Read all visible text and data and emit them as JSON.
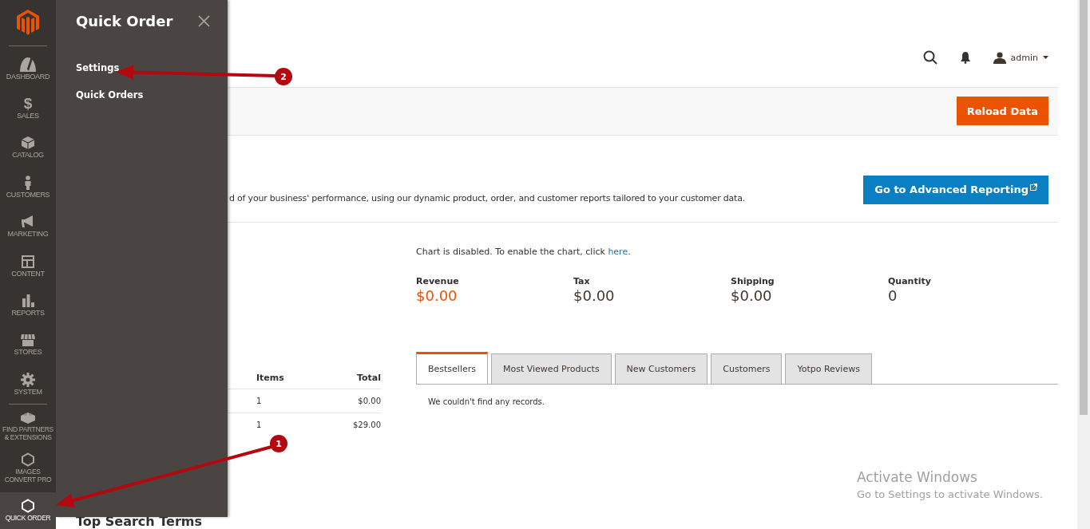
{
  "sidebar": {
    "items": [
      {
        "label": "DASHBOARD",
        "selected": false
      },
      {
        "label": "SALES",
        "glyph": "$",
        "selected": false
      },
      {
        "label": "CATALOG",
        "selected": false
      },
      {
        "label": "CUSTOMERS",
        "selected": false
      },
      {
        "label": "MARKETING",
        "selected": false
      },
      {
        "label": "CONTENT",
        "selected": false
      },
      {
        "label": "REPORTS",
        "selected": false
      },
      {
        "label": "STORES",
        "selected": false
      },
      {
        "label": "SYSTEM",
        "selected": false
      },
      {
        "label": "FIND PARTNERS & EXTENSIONS",
        "selected": false
      },
      {
        "label": "IMAGES CONVERT PRO",
        "selected": false
      },
      {
        "label": "QUICK ORDER",
        "selected": true
      }
    ]
  },
  "flyout": {
    "title": "Quick Order",
    "items": [
      "Settings",
      "Quick Orders"
    ]
  },
  "header": {
    "user": "admin"
  },
  "reload_button": "Reload Data",
  "reporting": {
    "description": "d of your business' performance, using our dynamic product, order, and customer reports tailored to your customer data.",
    "button": "Go to Advanced Reporting"
  },
  "chart_notice": {
    "text": "Chart is disabled. To enable the chart, click ",
    "link": "here",
    "end": "."
  },
  "totals": [
    {
      "label": "Revenue",
      "value": "$0.00",
      "highlight": true
    },
    {
      "label": "Tax",
      "value": "$0.00",
      "highlight": false
    },
    {
      "label": "Shipping",
      "value": "$0.00",
      "highlight": false
    },
    {
      "label": "Quantity",
      "value": "0",
      "highlight": false
    }
  ],
  "last_orders": {
    "columns": [
      "Items",
      "Total"
    ],
    "rows": [
      [
        "1",
        "$0.00"
      ],
      [
        "1",
        "$29.00"
      ]
    ]
  },
  "top_search_heading": "Top Search Terms",
  "tabs": [
    {
      "label": "Bestsellers",
      "selected": true
    },
    {
      "label": "Most Viewed Products",
      "selected": false
    },
    {
      "label": "New Customers",
      "selected": false
    },
    {
      "label": "Customers",
      "selected": false
    },
    {
      "label": "Yotpo Reviews",
      "selected": false
    }
  ],
  "tab_message": "We couldn't find any records.",
  "annotations": [
    {
      "number": "1"
    },
    {
      "number": "2"
    }
  ],
  "os_notice": {
    "title": "Activate Windows",
    "text": "Go to Settings to activate Windows."
  }
}
